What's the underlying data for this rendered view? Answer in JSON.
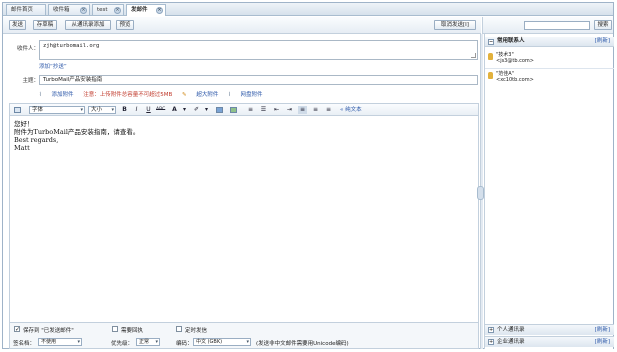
{
  "tabs": [
    {
      "label": "邮件首页"
    },
    {
      "label": "收件箱"
    },
    {
      "label": "test"
    },
    {
      "label": "发邮件"
    }
  ],
  "toolbar": {
    "send": "发送",
    "save_draft": "存草稿",
    "add_from_contacts": "从通讯录添加",
    "preview": "预览",
    "cancel_send": "取消发送[I]"
  },
  "search": {
    "button": "搜索",
    "value": ""
  },
  "compose": {
    "to_label": "收件人：",
    "to_value": "zjh@turbomail.org",
    "add_cc": "添加“抄送”",
    "subject_label": "主题：",
    "subject_value": "TurboMail产品安装指南",
    "add_attachment": "添加附件",
    "attachment_note": "注意：上传附件总容量不可超过5MB",
    "large_attachment": "超大附件",
    "netdisk_attachment": "网盘附件"
  },
  "format": {
    "font": "字体",
    "size": "大小",
    "bold": "B",
    "italic": "I",
    "underline": "U",
    "strike": "ABC",
    "font_color": "A",
    "plain_text": "« 纯文本"
  },
  "body": {
    "lines": [
      "您好！",
      "附件为TurboMail产品安装指南，请查看。",
      "",
      "Best regards,",
      "Matt"
    ]
  },
  "contacts": {
    "title": "常用联系人",
    "refresh": "[刷新]",
    "items": [
      {
        "name": "\"技术3\"",
        "email": "<js3@tb.com>"
      },
      {
        "name": "\"范佳A\"",
        "email": "<xc10tb.com>"
      }
    ],
    "personal": "个人通讯录",
    "enterprise": "企业通讯录",
    "personal_refresh": "[刷新]",
    "enterprise_refresh": "[刷新]"
  },
  "options": {
    "save_to_sent": "保存到 \"已发送邮件\"",
    "need_receipt": "需要回执",
    "scheduled": "定时发信",
    "signature_label": "签名档：",
    "signature_value": "不使用",
    "priority_label": "优先级：",
    "priority_value": "正常",
    "encoding_label": "编码：",
    "encoding_value": "中文 (GBK)",
    "encoding_note": "(发送非中文邮件需要用Unicode编码)"
  }
}
